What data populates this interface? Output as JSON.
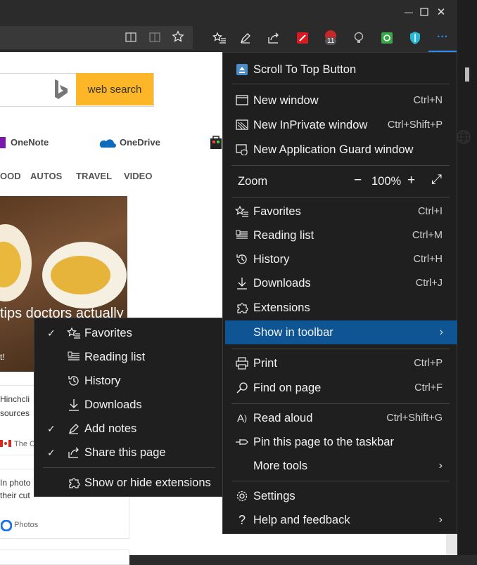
{
  "window": {
    "minimize_glyph": "—",
    "maximize_glyph": "☐",
    "close_glyph": "✕"
  },
  "toolbar": {
    "badge_count": "11",
    "more_glyph": "···"
  },
  "search": {
    "button_label": "web search"
  },
  "apps": [
    "OneNote",
    "OneDrive"
  ],
  "categories": [
    "OOD",
    "AUTOS",
    "TRAVEL",
    "VIDEO"
  ],
  "hero": {
    "text": "tips doctors actually",
    "sub": "t!"
  },
  "cards": [
    {
      "line1": "Hinchcli",
      "line2": "sources",
      "source": "The C"
    },
    {
      "line1": "In photo",
      "line2": "their cut",
      "source": "Photos"
    }
  ],
  "menu": {
    "scroll_to_top": "Scroll To Top Button",
    "new_window": {
      "label": "New window",
      "shortcut": "Ctrl+N"
    },
    "new_inprivate": {
      "label": "New InPrivate window",
      "shortcut": "Ctrl+Shift+P"
    },
    "new_guard": {
      "label": "New Application Guard window"
    },
    "zoom": {
      "label": "Zoom",
      "minus": "−",
      "value": "100%",
      "plus": "+",
      "fullscreen": "⤢"
    },
    "favorites": {
      "label": "Favorites",
      "shortcut": "Ctrl+I"
    },
    "reading_list": {
      "label": "Reading list",
      "shortcut": "Ctrl+M"
    },
    "history": {
      "label": "History",
      "shortcut": "Ctrl+H"
    },
    "downloads": {
      "label": "Downloads",
      "shortcut": "Ctrl+J"
    },
    "extensions": {
      "label": "Extensions"
    },
    "show_in_toolbar": {
      "label": "Show in toolbar",
      "chevron": "›"
    },
    "print": {
      "label": "Print",
      "shortcut": "Ctrl+P"
    },
    "find": {
      "label": "Find on page",
      "shortcut": "Ctrl+F"
    },
    "read_aloud": {
      "label": "Read aloud",
      "shortcut": "Ctrl+Shift+G"
    },
    "pin": {
      "label": "Pin this page to the taskbar"
    },
    "more_tools": {
      "label": "More tools",
      "chevron": "›"
    },
    "settings": {
      "label": "Settings"
    },
    "help": {
      "label": "Help and feedback",
      "chevron": "›"
    }
  },
  "submenu": {
    "check_glyph": "✓",
    "items": [
      {
        "label": "Favorites",
        "checked": true
      },
      {
        "label": "Reading list",
        "checked": false
      },
      {
        "label": "History",
        "checked": false
      },
      {
        "label": "Downloads",
        "checked": false
      },
      {
        "label": "Add notes",
        "checked": true
      },
      {
        "label": "Share this page",
        "checked": true
      }
    ],
    "show_hide_extensions": "Show or hide extensions"
  },
  "colors": {
    "accent": "#0f5493",
    "menu_bg": "#1f1f1f",
    "search_btn": "#fdb627"
  }
}
